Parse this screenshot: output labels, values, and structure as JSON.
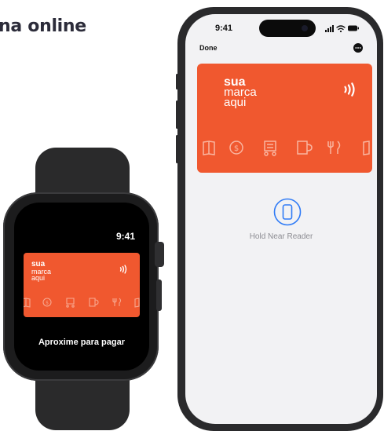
{
  "heading": "na online",
  "watch": {
    "time": "9:41",
    "brand": [
      "sua",
      "marca",
      "aqui"
    ],
    "caption": "Aproxime para pagar",
    "icons": [
      "book-icon",
      "coin-icon",
      "shopping-cart-icon",
      "coffee-mug-icon",
      "fork-knife-icon"
    ]
  },
  "phone": {
    "time": "9:41",
    "done_label": "Done",
    "brand": [
      "sua",
      "marca",
      "aqui"
    ],
    "reader_label": "Hold Near Reader",
    "icons": [
      "book-icon",
      "coin-icon",
      "shopping-cart-icon",
      "coffee-mug-icon",
      "fork-knife-icon"
    ]
  },
  "colors": {
    "card": "#f0582f",
    "accent_blue": "#2f7bf6",
    "watch_body": "#1c1c1d"
  }
}
